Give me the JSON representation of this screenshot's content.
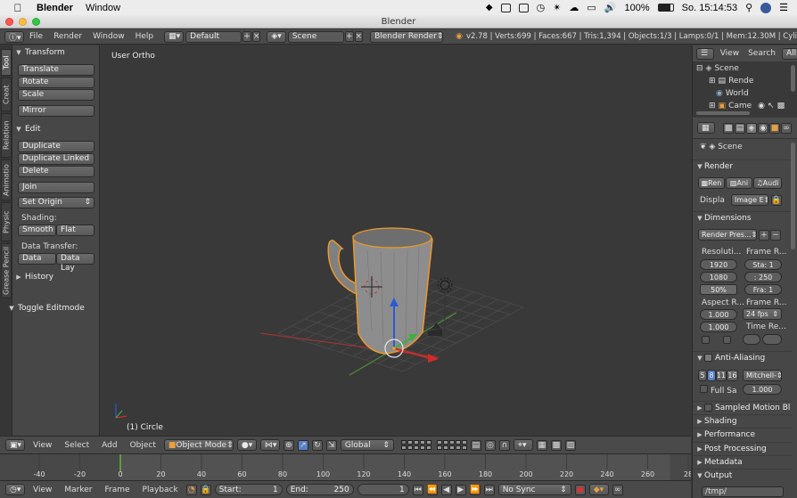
{
  "mac_menubar": {
    "app_name": "Blender",
    "menu_window": "Window",
    "battery": "100%",
    "clock": "So. 15:14:53"
  },
  "window": {
    "title": "Blender"
  },
  "info_header": {
    "menus": [
      "File",
      "Render",
      "Window",
      "Help"
    ],
    "screen_layout": "Default",
    "scene": "Scene",
    "render_engine": "Blender Render",
    "stats": "v2.78 | Verts:699 | Faces:667 | Tris:1,394 | Objects:1/3 | Lamps:0/1 | Mem:12.30M | Cyli"
  },
  "side_tabs": [
    "Tool",
    "Creat",
    "Relation",
    "Animatio",
    "Physic",
    "Grease Pencil"
  ],
  "tool_shelf": {
    "transform_title": "Transform",
    "translate": "Translate",
    "rotate": "Rotate",
    "scale": "Scale",
    "mirror": "Mirror",
    "edit_title": "Edit",
    "duplicate": "Duplicate",
    "duplicate_linked": "Duplicate Linked",
    "delete": "Delete",
    "join": "Join",
    "set_origin": "Set Origin",
    "shading_label": "Shading:",
    "smooth": "Smooth",
    "flat": "Flat",
    "data_transfer_label": "Data Transfer:",
    "data": "Data",
    "data_lay": "Data Lay",
    "history_title": "History",
    "toggle_editmode_title": "Toggle Editmode"
  },
  "viewport": {
    "view_label": "User Ortho",
    "object_label": "(1) Circle"
  },
  "view3d_header": {
    "menus": [
      "View",
      "Select",
      "Add",
      "Object"
    ],
    "mode": "Object Mode",
    "orientation": "Global"
  },
  "timeline": {
    "ticks": [
      "-40",
      "-20",
      "0",
      "20",
      "40",
      "60",
      "80",
      "100",
      "120",
      "140",
      "160",
      "180",
      "200",
      "220",
      "240",
      "260",
      "28"
    ],
    "current_frame_tick": 0
  },
  "timeline_header": {
    "menus": [
      "View",
      "Marker",
      "Frame",
      "Playback"
    ],
    "start_label": "Start:",
    "start_value": "1",
    "end_label": "End:",
    "end_value": "250",
    "current_frame": "1",
    "sync": "No Sync"
  },
  "outliner": {
    "menus": [
      "View",
      "Search",
      "All"
    ],
    "items": [
      "Scene",
      "Rende",
      "World",
      "Came"
    ]
  },
  "properties": {
    "context": "Scene",
    "render_title": "Render",
    "render_btns": [
      "Ren",
      "Ani",
      "Audi"
    ],
    "display_label": "Displa",
    "display_value": "Image E",
    "dimensions_title": "Dimensions",
    "render_presets": "Render Pres...",
    "resolution_label": "Resoluti...",
    "frame_range_label": "Frame R...",
    "res_x": "1920",
    "res_y": "1080",
    "res_pct": "50%",
    "frame_start": "Sta: 1",
    "frame_end": ": 250",
    "frame_step": "Fra: 1",
    "aspect_label": "Aspect R...",
    "frame_rate_label": "Frame R...",
    "aspect_x": "1.000",
    "aspect_y": "1.000",
    "fps": "24 fps",
    "time_remap_label": "Time Re...",
    "aa_title": "Anti-Aliasing",
    "aa_samples": [
      "5",
      "8",
      "11",
      "16"
    ],
    "aa_filter": "Mitchell-",
    "full_sample": "Full Sa",
    "aa_size": "1.000",
    "sampled_motion": "Sampled Motion Bl",
    "shading": "Shading",
    "performance": "Performance",
    "post_processing": "Post Processing",
    "metadata": "Metadata",
    "output": "Output",
    "output_path": "/tmp/"
  }
}
